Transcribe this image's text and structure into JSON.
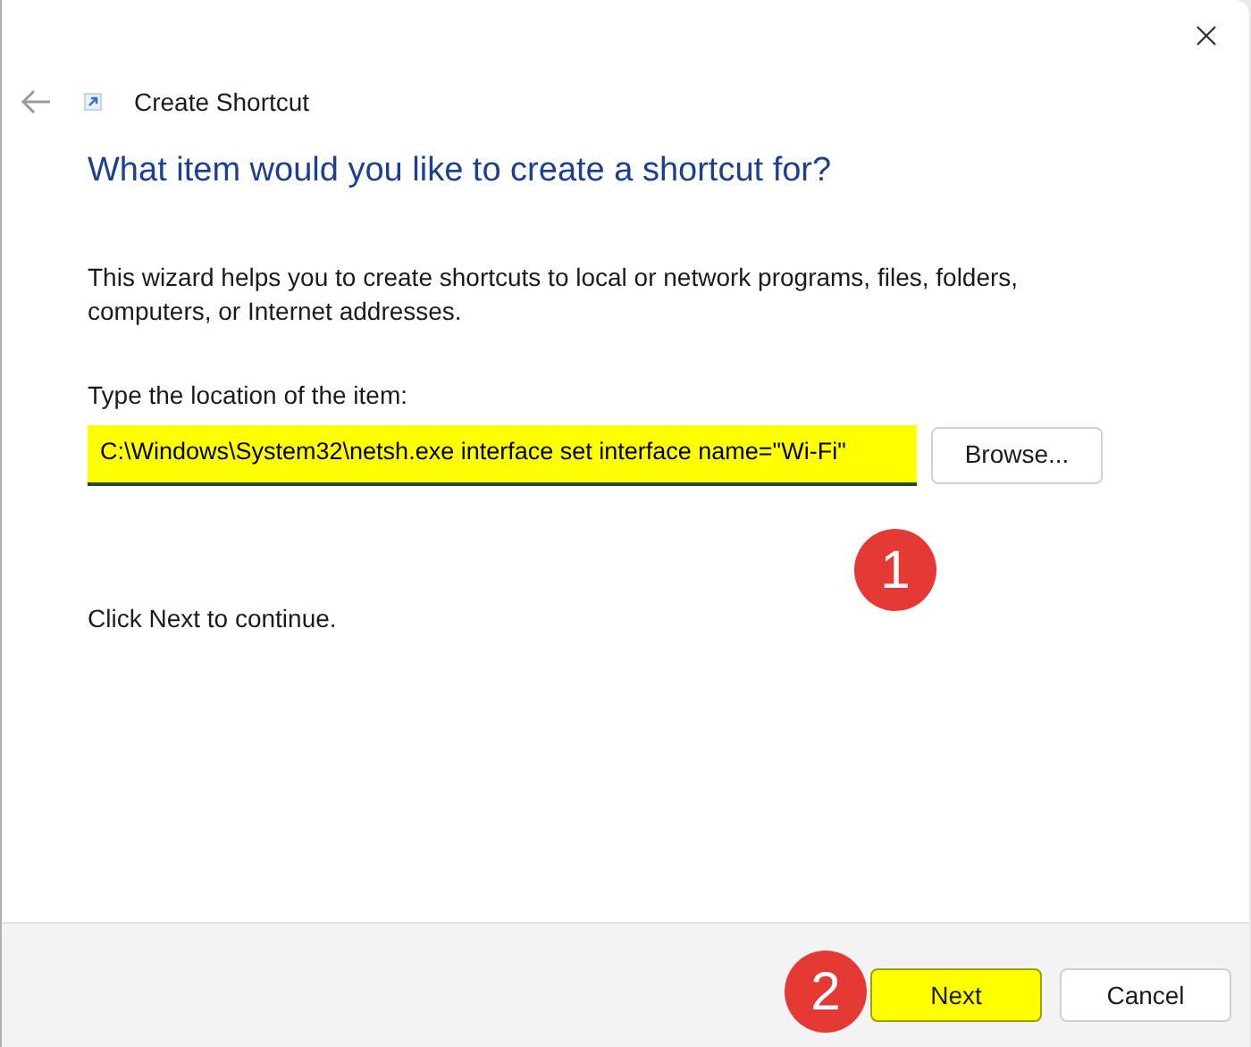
{
  "window": {
    "title": "Create Shortcut"
  },
  "heading": "What item would you like to create a shortcut for?",
  "description": "This wizard helps you to create shortcuts to local or network programs, files, folders, computers, or Internet addresses.",
  "location": {
    "label": "Type the location of the item:",
    "value": "C:\\Windows\\System32\\netsh.exe interface set interface name=\"Wi-Fi\"",
    "highlighted": true
  },
  "browse_button": "Browse...",
  "hint": "Click Next to continue.",
  "buttons": [
    {
      "label": "Next",
      "highlighted": true
    },
    {
      "label": "Cancel",
      "highlighted": false
    }
  ],
  "annotations": [
    "1",
    "2"
  ]
}
